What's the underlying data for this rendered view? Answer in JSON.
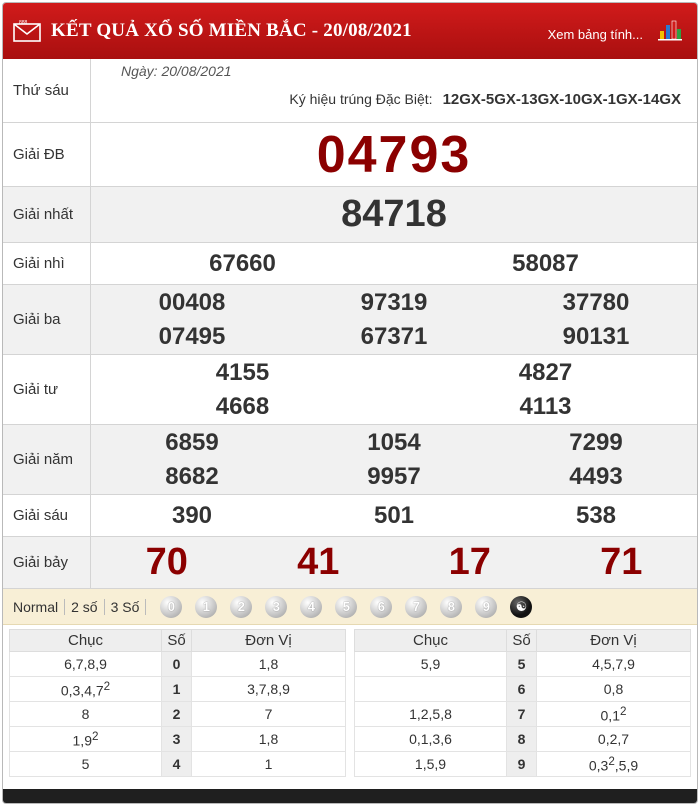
{
  "header": {
    "title": "KẾT QUẢ XỔ SỐ MIỀN BẮC - 20/08/2021",
    "link": "Xem bảng tính..."
  },
  "info": {
    "weekday": "Thứ sáu",
    "date": "Ngày: 20/08/2021",
    "kh_label": "Ký hiệu trúng Đặc Biệt:",
    "kh_value": "12GX-5GX-13GX-10GX-1GX-14GX"
  },
  "prizes": {
    "db": {
      "label": "Giải ĐB",
      "value": "04793"
    },
    "nhat": {
      "label": "Giải nhất",
      "value": "84718"
    },
    "nhi": {
      "label": "Giải nhì",
      "values": [
        "67660",
        "58087"
      ]
    },
    "ba": {
      "label": "Giải ba",
      "values": [
        "00408",
        "97319",
        "37780",
        "07495",
        "67371",
        "90131"
      ]
    },
    "tu": {
      "label": "Giải tư",
      "values": [
        "4155",
        "4827",
        "4668",
        "4113"
      ]
    },
    "nam": {
      "label": "Giải năm",
      "values": [
        "6859",
        "1054",
        "7299",
        "8682",
        "9957",
        "4493"
      ]
    },
    "sau": {
      "label": "Giải sáu",
      "values": [
        "390",
        "501",
        "538"
      ]
    },
    "bay": {
      "label": "Giải bảy",
      "values": [
        "70",
        "41",
        "17",
        "71"
      ]
    }
  },
  "toolbar": {
    "options": [
      "Normal",
      "2 số",
      "3 Số"
    ],
    "balls": [
      "0",
      "1",
      "2",
      "3",
      "4",
      "5",
      "6",
      "7",
      "8",
      "9"
    ]
  },
  "loto": {
    "headers": [
      "Chục",
      "Số",
      "Đơn Vị"
    ],
    "left": [
      {
        "chuc": "6,7,8,9",
        "so": "0",
        "donvi": "1,8"
      },
      {
        "chuc": "0,3,4,7",
        "chuc_sup": "2",
        "so": "1",
        "donvi": "3,7,8,9"
      },
      {
        "chuc": "8",
        "so": "2",
        "donvi": "7"
      },
      {
        "chuc": "1,9",
        "chuc_sup": "2",
        "so": "3",
        "donvi": "1,8"
      },
      {
        "chuc": "5",
        "so": "4",
        "donvi": "1"
      }
    ],
    "right": [
      {
        "chuc": "5,9",
        "so": "5",
        "donvi": "4,5,7,9"
      },
      {
        "chuc": "",
        "so": "6",
        "donvi": "0,8"
      },
      {
        "chuc": "1,2,5,8",
        "so": "7",
        "donvi": "0,1",
        "donvi_sup": "2"
      },
      {
        "chuc": "0,1,3,6",
        "so": "8",
        "donvi": "0,2,7"
      },
      {
        "chuc": "1,5,9",
        "so": "9",
        "donvi_pre": "0,3",
        "donvi_sup": "2",
        "donvi": ",5,9"
      }
    ]
  },
  "colors": {
    "header_red": "#c41515",
    "prize_red": "#8b0000",
    "toolbar_bg": "#f8efd6"
  }
}
